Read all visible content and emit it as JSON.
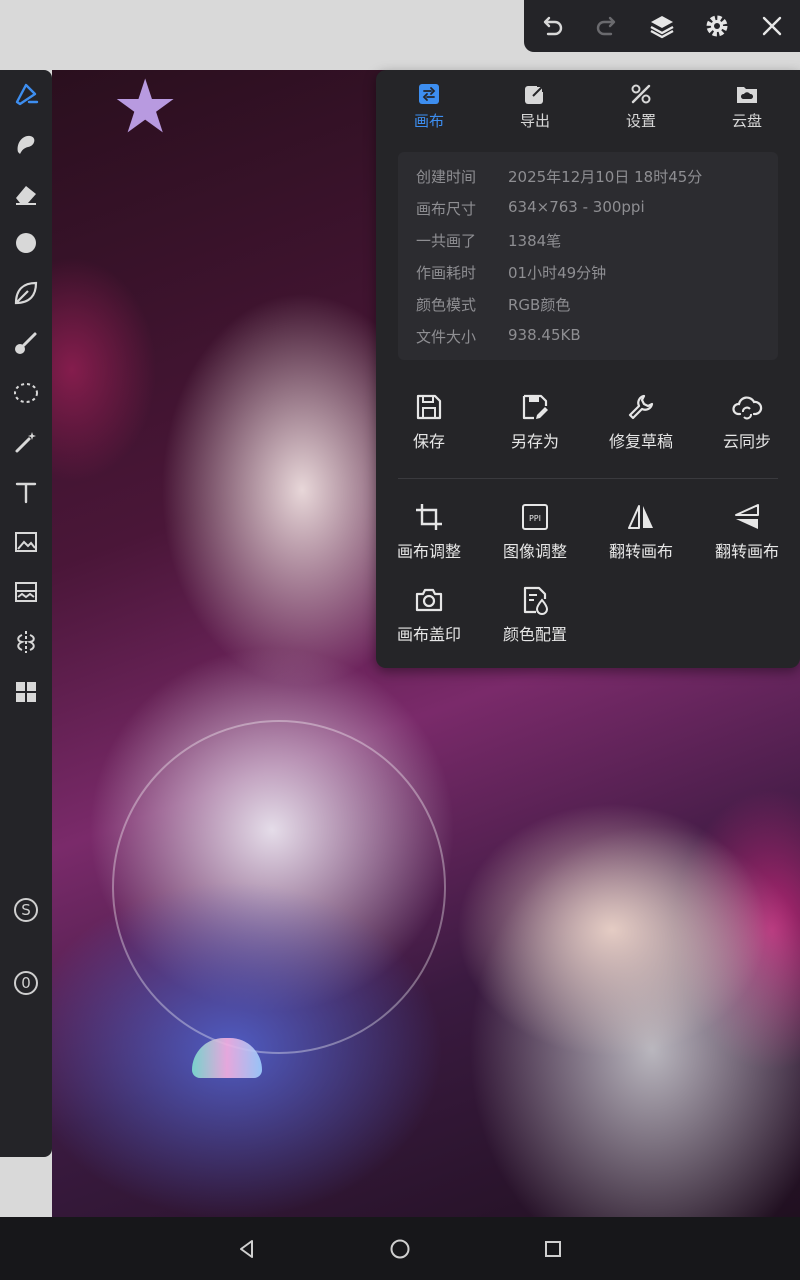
{
  "colors": {
    "accent": "#3d8ef0",
    "panel": "#252528",
    "panel_inner": "#2c2c30"
  },
  "topbar": {
    "icons": [
      "undo-icon",
      "redo-icon",
      "layers-icon",
      "settings-icon",
      "close-icon"
    ]
  },
  "leftbar": {
    "tools": [
      "brush-tool-icon",
      "smudge-icon",
      "eraser-icon",
      "fill-circle-icon",
      "leaf-brush-icon",
      "paint-bucket-icon",
      "lasso-icon",
      "magic-wand-icon",
      "text-icon",
      "image-import-icon",
      "filter-icon",
      "symmetry-icon",
      "grid-layout-icon"
    ],
    "badge_s": "S",
    "badge_0": "0"
  },
  "panel": {
    "tabs": [
      {
        "label": "画布",
        "icon": "canvas-icon",
        "active": true
      },
      {
        "label": "导出",
        "icon": "export-icon",
        "active": false
      },
      {
        "label": "设置",
        "icon": "tools-icon",
        "active": false
      },
      {
        "label": "云盘",
        "icon": "cloud-folder-icon",
        "active": false
      }
    ],
    "info": [
      {
        "key": "创建时间",
        "value": "2025年12月10日 18时45分"
      },
      {
        "key": "画布尺寸",
        "value": "634×763 - 300ppi"
      },
      {
        "key": "一共画了",
        "value": "1384笔"
      },
      {
        "key": "作画耗时",
        "value": "01小时49分钟"
      },
      {
        "key": "颜色模式",
        "value": "RGB颜色"
      },
      {
        "key": "文件大小",
        "value": "938.45KB"
      }
    ],
    "actions_row1": [
      {
        "label": "保存",
        "icon": "save-icon"
      },
      {
        "label": "另存为",
        "icon": "save-as-icon"
      },
      {
        "label": "修复草稿",
        "icon": "wrench-icon"
      },
      {
        "label": "云同步",
        "icon": "cloud-sync-icon"
      }
    ],
    "actions_row2": [
      {
        "label": "画布调整",
        "icon": "crop-icon"
      },
      {
        "label": "图像调整",
        "icon": "ppi-icon",
        "badge": "PPI"
      },
      {
        "label": "翻转画布",
        "icon": "flip-horizontal-icon"
      },
      {
        "label": "翻转画布",
        "icon": "flip-vertical-icon"
      }
    ],
    "actions_row3": [
      {
        "label": "画布盖印",
        "icon": "camera-icon"
      },
      {
        "label": "颜色配置",
        "icon": "color-config-icon"
      }
    ]
  },
  "navbar": {
    "icons": [
      "back-icon",
      "home-icon",
      "recents-icon"
    ]
  }
}
